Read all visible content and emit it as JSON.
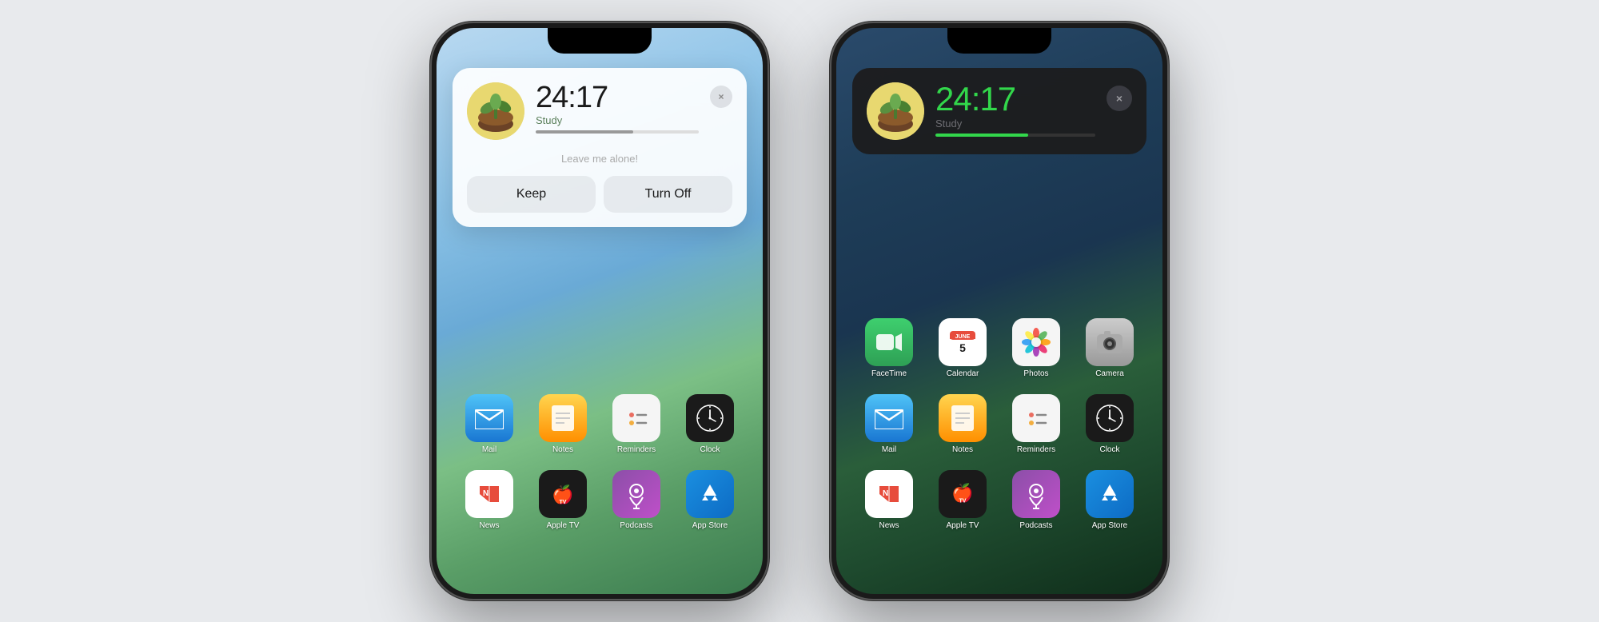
{
  "page": {
    "background": "#e8eaed"
  },
  "phone1": {
    "mode": "light",
    "widget": {
      "time": "24:17",
      "label": "Study",
      "progress": 60,
      "message": "Leave me alone!",
      "keep_label": "Keep",
      "turnoff_label": "Turn Off",
      "close_icon": "×"
    },
    "app_rows": [
      [
        {
          "name": "Mail",
          "icon": "mail"
        },
        {
          "name": "Notes",
          "icon": "notes"
        },
        {
          "name": "Reminders",
          "icon": "reminders"
        },
        {
          "name": "Clock",
          "icon": "clock"
        }
      ],
      [
        {
          "name": "News",
          "icon": "news"
        },
        {
          "name": "Apple TV",
          "icon": "appletv"
        },
        {
          "name": "Podcasts",
          "icon": "podcasts"
        },
        {
          "name": "App Store",
          "icon": "appstore"
        }
      ]
    ]
  },
  "phone2": {
    "mode": "dark",
    "widget": {
      "time": "24:17",
      "label": "Study",
      "progress": 58,
      "close_icon": "×"
    },
    "app_rows": [
      [
        {
          "name": "FaceTime",
          "icon": "facetime"
        },
        {
          "name": "Calendar",
          "icon": "calendar"
        },
        {
          "name": "Photos",
          "icon": "photos"
        },
        {
          "name": "Camera",
          "icon": "camera"
        }
      ],
      [
        {
          "name": "Mail",
          "icon": "mail"
        },
        {
          "name": "Notes",
          "icon": "notes"
        },
        {
          "name": "Reminders",
          "icon": "reminders"
        },
        {
          "name": "Clock",
          "icon": "clock"
        }
      ],
      [
        {
          "name": "News",
          "icon": "news"
        },
        {
          "name": "Apple TV",
          "icon": "appletv"
        },
        {
          "name": "Podcasts",
          "icon": "podcasts"
        },
        {
          "name": "App Store",
          "icon": "appstore"
        }
      ]
    ]
  }
}
